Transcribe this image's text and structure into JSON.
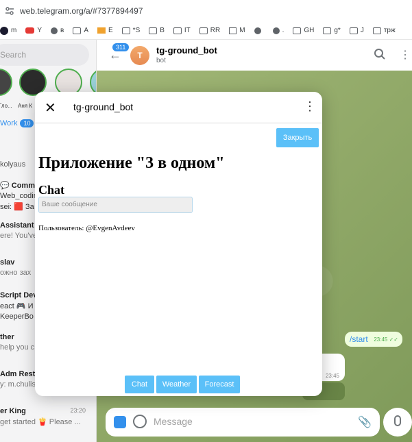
{
  "browser": {
    "url": "web.telegram.org/a/#7377894497",
    "bookmarks": [
      {
        "label": "m",
        "icon": "ad-icon"
      },
      {
        "label": "Y",
        "icon": "youtube-icon"
      },
      {
        "label": "в",
        "icon": "globe-icon"
      },
      {
        "label": "A",
        "icon": "folder-icon"
      },
      {
        "label": "E",
        "icon": "mail-icon"
      },
      {
        "label": "*S",
        "icon": "folder-icon"
      },
      {
        "label": "B",
        "icon": "folder-icon"
      },
      {
        "label": "IT",
        "icon": "folder-icon"
      },
      {
        "label": "RR",
        "icon": "folder-icon"
      },
      {
        "label": "M",
        "icon": "mailbox-icon"
      },
      {
        "label": "",
        "icon": "globe-icon"
      },
      {
        "label": ".",
        "icon": "globe-icon"
      },
      {
        "label": "GH",
        "icon": "folder-icon"
      },
      {
        "label": "g*",
        "icon": "folder-icon"
      },
      {
        "label": "J",
        "icon": "folder-icon"
      },
      {
        "label": "трж",
        "icon": "folder-icon"
      }
    ]
  },
  "sidebar": {
    "search_placeholder": "Search",
    "stories": [
      "Гло...",
      "Аня К",
      "",
      ""
    ],
    "folder": {
      "label": "Work",
      "count": "10"
    },
    "chats": [
      {
        "title": "kolyaus",
        "snippet": "",
        "time": ""
      },
      {
        "title": "💬 Comm",
        "snippet": "Web_coding",
        "time": ""
      },
      {
        "title": "",
        "snippet": "sei: 🟥 За",
        "time": ""
      },
      {
        "title": "Assistant",
        "snippet": "ere! You've",
        "time": ""
      },
      {
        "title": "slav",
        "snippet": "ожно зах",
        "time": ""
      },
      {
        "title": "Script Dev",
        "snippet": "eact 🎮 И",
        "time": ""
      },
      {
        "title": "",
        "snippet": "KeeperBo",
        "time": ""
      },
      {
        "title": "ther",
        "snippet": "help you c",
        "time": ""
      },
      {
        "title": "Adm Resta",
        "snippet": "y: m.chulis",
        "time": ""
      },
      {
        "title": "er King",
        "snippet": "get started 🍟 Please ...",
        "time": "23:20"
      }
    ]
  },
  "chat_header": {
    "unread_count": "311",
    "avatar_letter": "T",
    "title": "tg-ground_bot",
    "subtitle": "bot"
  },
  "messages": [
    {
      "text": "/start",
      "time": "23:45",
      "outgoing": true
    },
    {
      "text": "",
      "time": "23:45",
      "outgoing": false
    }
  ],
  "composer": {
    "placeholder": "Message"
  },
  "modal": {
    "title": "tg-ground_bot",
    "close_button": "Закрыть",
    "app_title": "Приложение \"3 в одном\"",
    "section_heading": "Chat",
    "input_placeholder": "Ваше сообщение",
    "user_line": "Пользователь: @EvgenAvdeev",
    "tabs": [
      "Chat",
      "Weather",
      "Forecast"
    ]
  },
  "colors": {
    "telegram_blue": "#3390ec",
    "webapp_button": "#5bc0f8",
    "chat_bg": "#8ea86a"
  }
}
